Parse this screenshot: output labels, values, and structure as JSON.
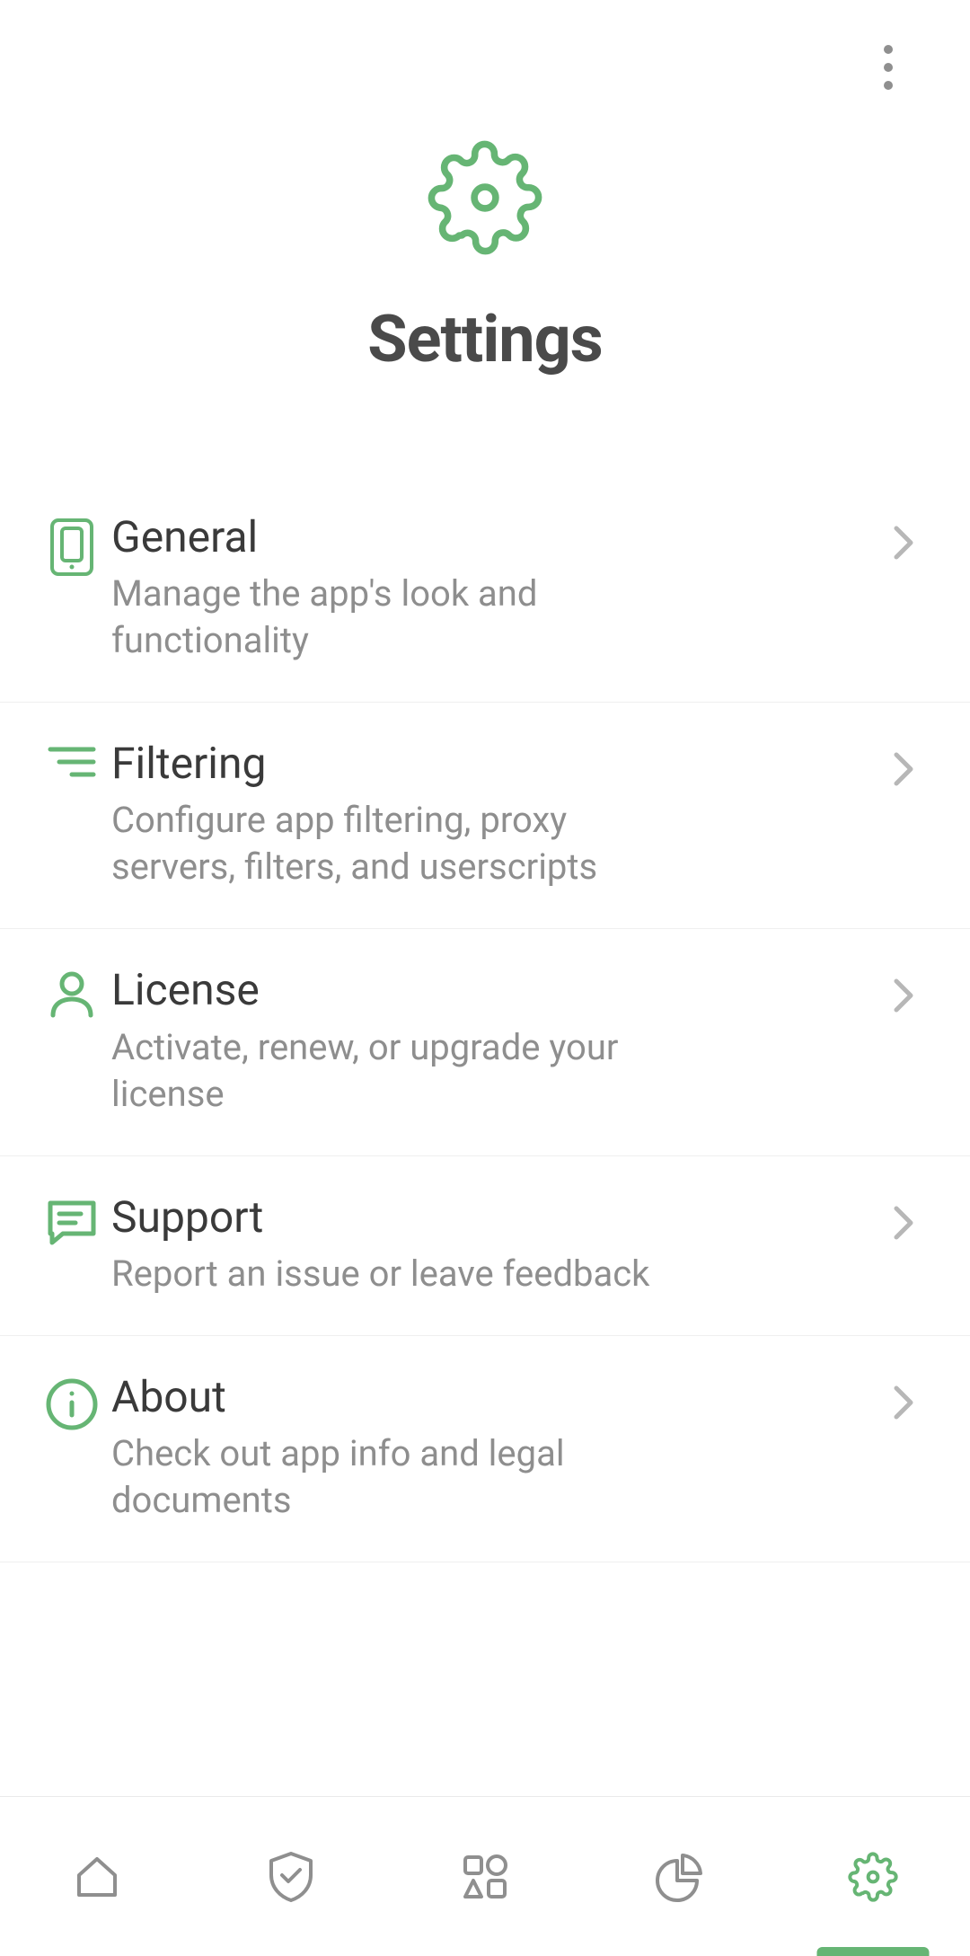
{
  "colors": {
    "accent": "#66b574",
    "text": "#3a3a3a",
    "muted": "#8e8e8e"
  },
  "page": {
    "title": "Settings"
  },
  "items": [
    {
      "icon": "phone",
      "title": "General",
      "subtitle": "Manage the app's look and functionality"
    },
    {
      "icon": "filter",
      "title": "Filtering",
      "subtitle": "Configure app filtering, proxy servers, filters, and userscripts"
    },
    {
      "icon": "user",
      "title": "License",
      "subtitle": "Activate, renew, or upgrade your license"
    },
    {
      "icon": "chat",
      "title": "Support",
      "subtitle": "Report an issue or leave feedback"
    },
    {
      "icon": "info",
      "title": "About",
      "subtitle": "Check out app info and legal documents"
    }
  ],
  "nav": [
    {
      "icon": "home",
      "active": false
    },
    {
      "icon": "shield",
      "active": false
    },
    {
      "icon": "shapes",
      "active": false
    },
    {
      "icon": "stats",
      "active": false
    },
    {
      "icon": "gear",
      "active": true
    }
  ]
}
